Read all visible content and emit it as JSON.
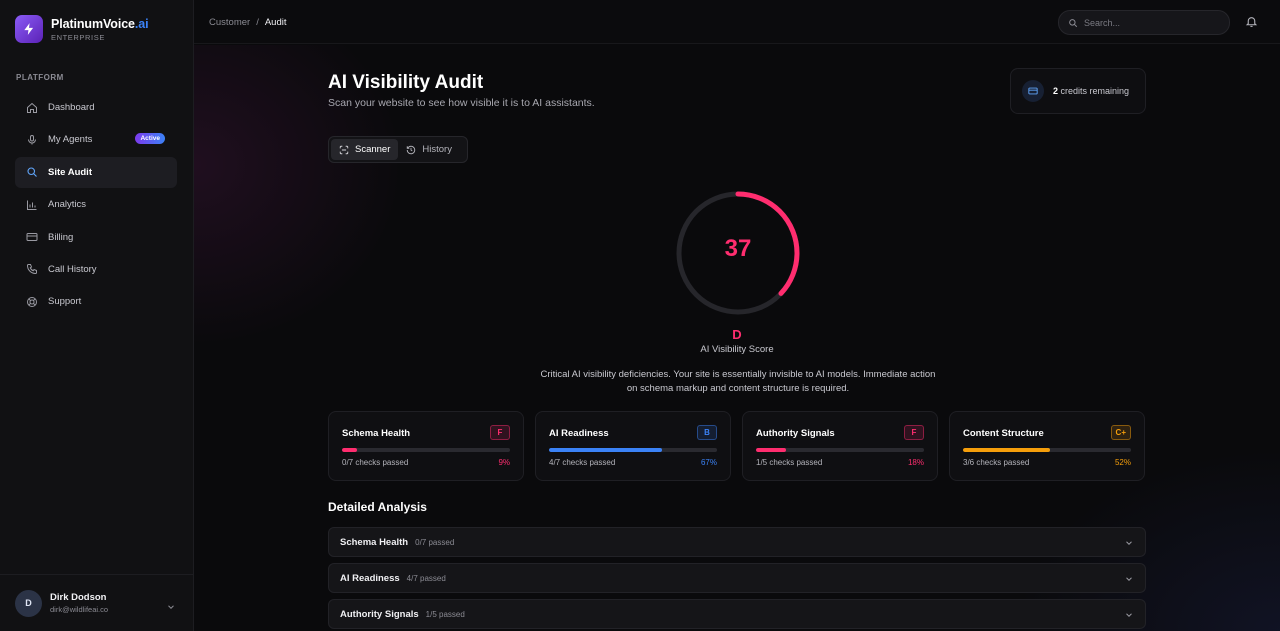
{
  "brand": {
    "name": "PlatinumVoice",
    "name_accent": ".ai",
    "tier": "ENTERPRISE",
    "icon": "lightning-icon"
  },
  "sidebar": {
    "section_label": "PLATFORM",
    "items": [
      {
        "label": "Dashboard",
        "icon": "home-icon"
      },
      {
        "label": "My Agents",
        "icon": "microphone-icon",
        "badge": "Active"
      },
      {
        "label": "Site Audit",
        "icon": "search-icon",
        "active": true
      },
      {
        "label": "Analytics",
        "icon": "bar-chart-icon"
      },
      {
        "label": "Billing",
        "icon": "credit-card-icon"
      },
      {
        "label": "Call History",
        "icon": "phone-icon"
      },
      {
        "label": "Support",
        "icon": "lifebuoy-icon"
      }
    ],
    "user": {
      "initial": "D",
      "name": "Dirk Dodson",
      "email": "dirk@wildlifeai.co"
    }
  },
  "header": {
    "breadcrumb": [
      "Customer",
      "Audit"
    ],
    "breadcrumb_separator": "/",
    "search_placeholder": "Search..."
  },
  "main": {
    "title": "AI Visibility Audit",
    "subtitle": "Scan your website to see how visible it is to AI assistants.",
    "credits": {
      "count": "2",
      "label": "credits remaining"
    },
    "tabs": [
      {
        "label": "Scanner",
        "icon": "scan-icon",
        "active": true
      },
      {
        "label": "History",
        "icon": "history-icon"
      }
    ],
    "score": {
      "value": "37",
      "max": 100,
      "grade": "D",
      "label": "AI Visibility Score",
      "color": "#ff2d6f"
    },
    "description": "Critical AI visibility deficiencies. Your site is essentially invisible to AI models. Immediate action on schema markup and content structure is required.",
    "categories": [
      {
        "title": "Schema Health",
        "grade": "F",
        "checks": "0/7 checks passed",
        "percent": "9%",
        "fraction": 0.09,
        "color": "#ff2d6f"
      },
      {
        "title": "AI Readiness",
        "grade": "B",
        "checks": "4/7 checks passed",
        "percent": "67%",
        "fraction": 0.67,
        "color": "#3b82f6"
      },
      {
        "title": "Authority Signals",
        "grade": "F",
        "checks": "1/5 checks passed",
        "percent": "18%",
        "fraction": 0.18,
        "color": "#ff2d6f"
      },
      {
        "title": "Content Structure",
        "grade": "C+",
        "checks": "3/6 checks passed",
        "percent": "52%",
        "fraction": 0.52,
        "color": "#f59e0b"
      }
    ],
    "detailed_title": "Detailed Analysis",
    "details": [
      {
        "name": "Schema Health",
        "sub": "0/7 passed"
      },
      {
        "name": "AI Readiness",
        "sub": "4/7 passed"
      },
      {
        "name": "Authority Signals",
        "sub": "1/5 passed"
      }
    ]
  }
}
